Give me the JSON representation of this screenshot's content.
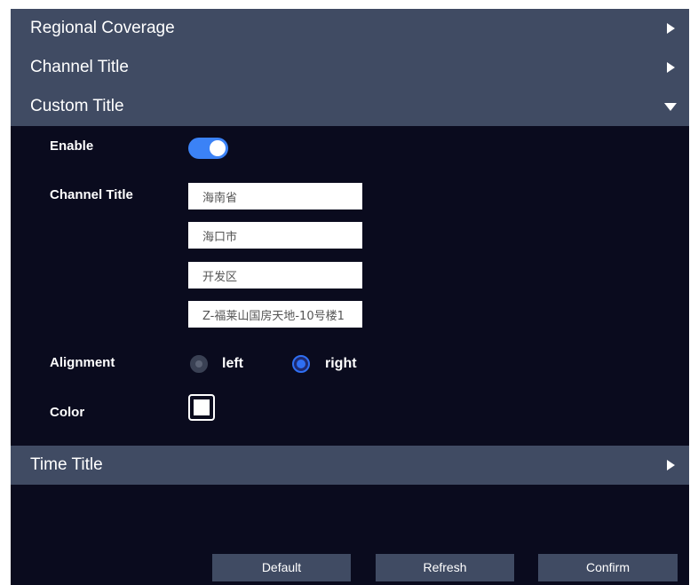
{
  "sections": {
    "regional_coverage": {
      "title": "Regional Coverage",
      "expanded": false
    },
    "channel_title": {
      "title": "Channel Title",
      "expanded": false
    },
    "custom_title": {
      "title": "Custom Title",
      "expanded": true
    },
    "time_title": {
      "title": "Time Title",
      "expanded": false
    }
  },
  "custom_title_form": {
    "enable_label": "Enable",
    "enabled": true,
    "channel_title_label": "Channel Title",
    "lines": [
      "海南省",
      "海口市",
      "开发区",
      "Z-福莱山国房天地-10号楼1"
    ],
    "alignment_label": "Alignment",
    "alignment_options": [
      "left",
      "right"
    ],
    "alignment_selected": "right",
    "color_label": "Color",
    "color_value": "#ffffff"
  },
  "buttons": {
    "default_label": "Default",
    "refresh_label": "Refresh",
    "confirm_label": "Confirm"
  },
  "colors": {
    "background": "#0a0b1e",
    "header": "#404b63",
    "accent": "#3b82f6"
  }
}
